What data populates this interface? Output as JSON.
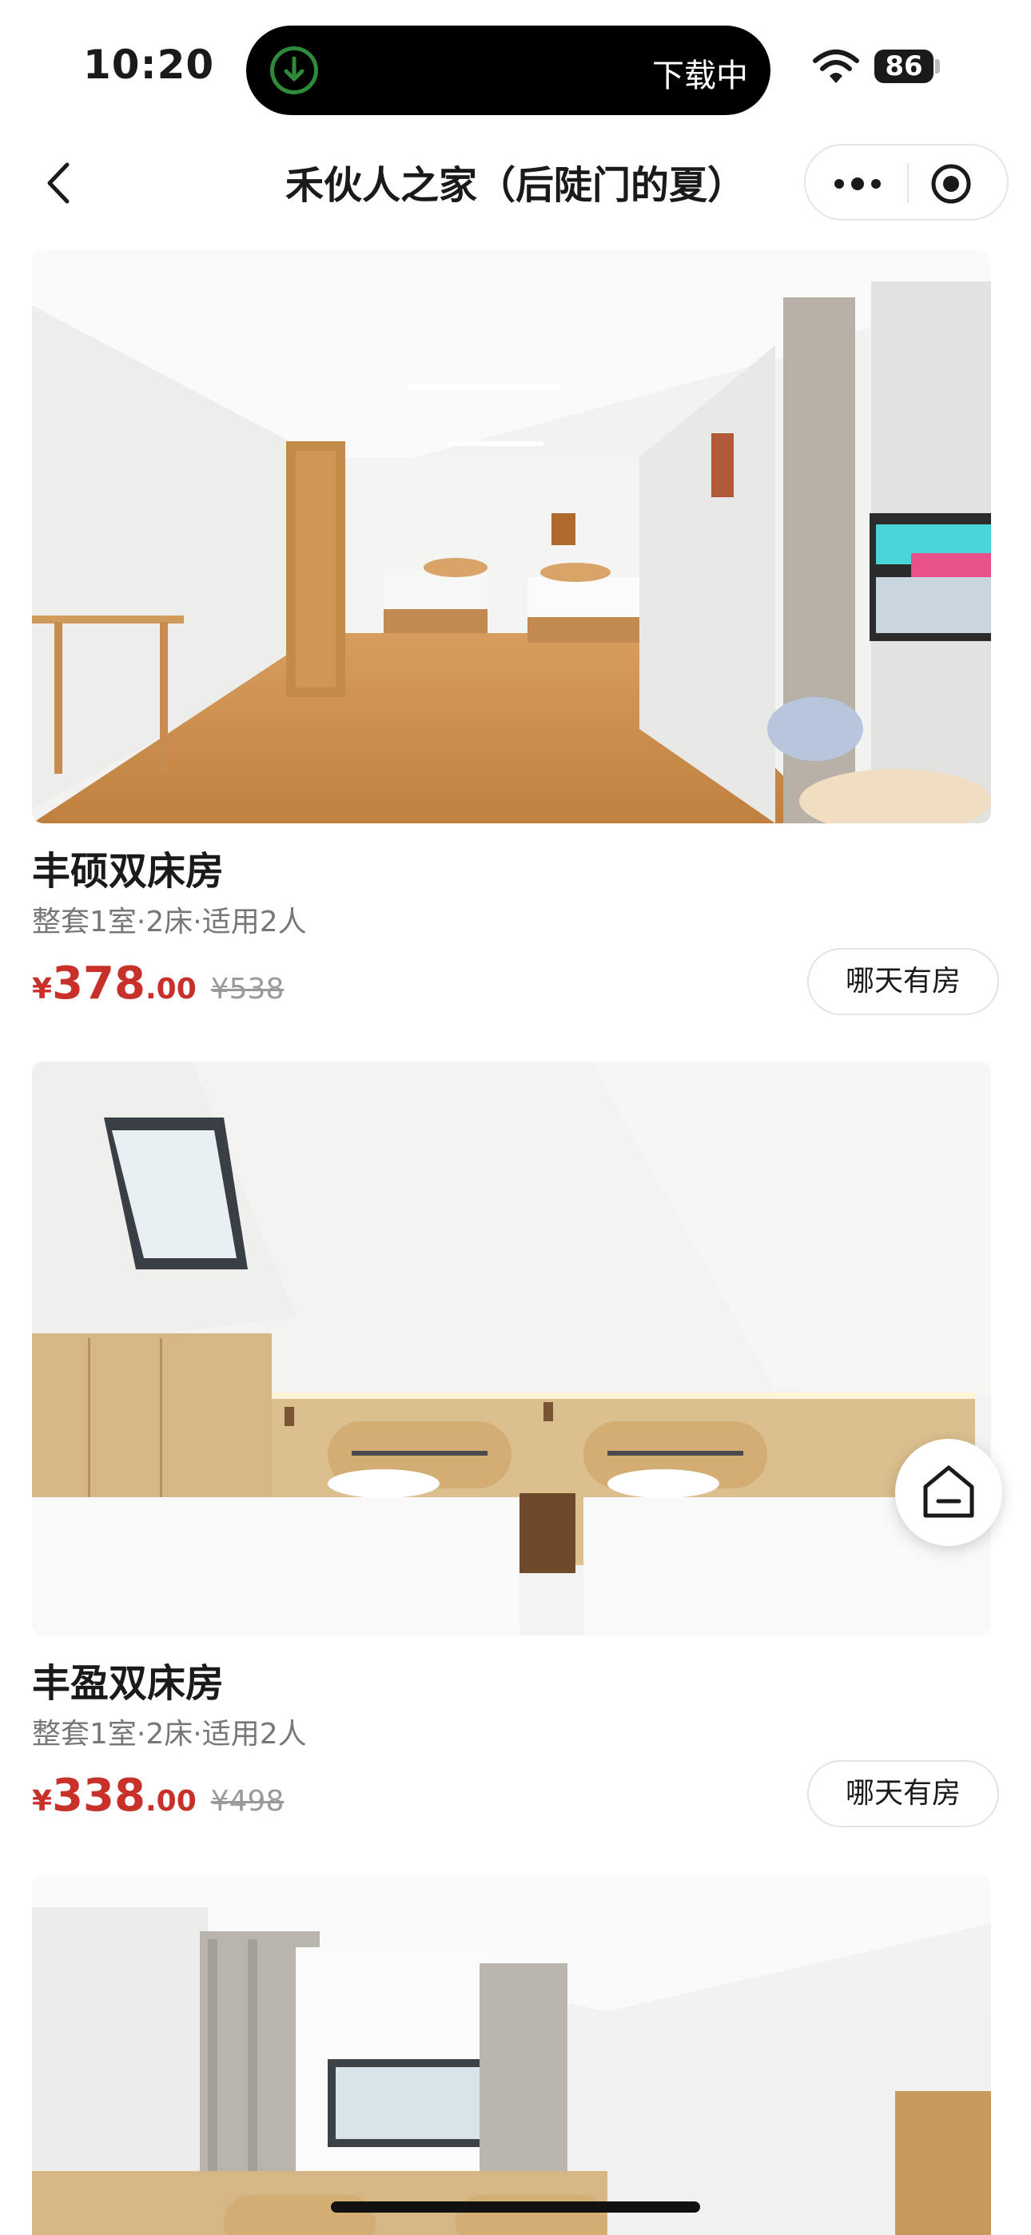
{
  "status_bar": {
    "time": "10:20",
    "island_text": "下载中",
    "battery": "86"
  },
  "nav": {
    "title": "禾伙人之家（后陡门的夏）"
  },
  "rooms": [
    {
      "name": "丰硕双床房",
      "spec": "整套1室·2床·适用2人",
      "currency": "¥",
      "price_int": "378",
      "price_dec": ".00",
      "original_price": "¥538",
      "button": "哪天有房"
    },
    {
      "name": "丰盈双床房",
      "spec": "整套1室·2床·适用2人",
      "currency": "¥",
      "price_int": "338",
      "price_dec": ".00",
      "original_price": "¥498",
      "button": "哪天有房"
    }
  ],
  "colors": {
    "price_red": "#c8302a",
    "download_green": "#2e8b3a"
  }
}
